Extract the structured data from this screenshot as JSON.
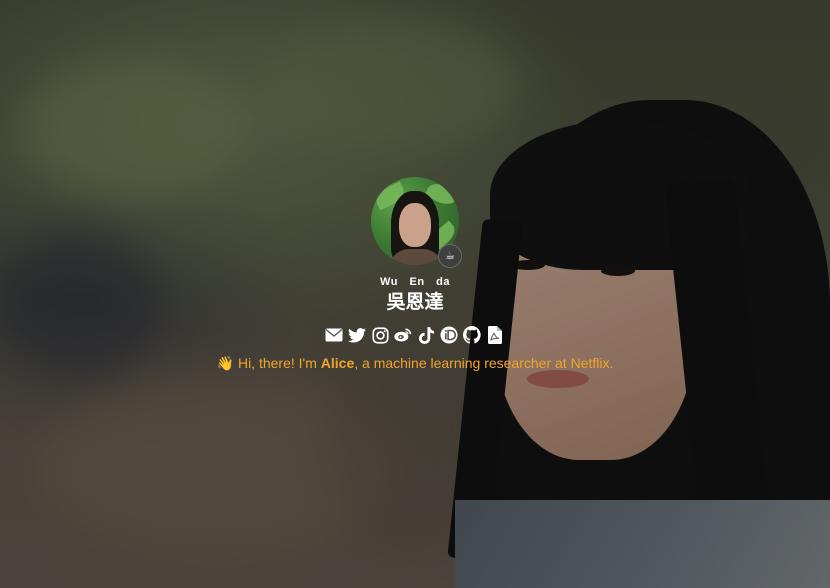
{
  "profile": {
    "name_romanized": "Wu En da",
    "name_chinese": "吳恩達",
    "avatar_badge_icon": "coffee-icon",
    "tagline_prefix": "👋 Hi, there! I'm ",
    "tagline_name": "Alice",
    "tagline_suffix": ", a machine learning researcher at Netflix."
  },
  "social_links": [
    {
      "name": "email",
      "icon": "email-icon"
    },
    {
      "name": "twitter",
      "icon": "twitter-icon"
    },
    {
      "name": "instagram",
      "icon": "instagram-icon"
    },
    {
      "name": "weibo",
      "icon": "weibo-icon"
    },
    {
      "name": "tiktok",
      "icon": "tiktok-icon"
    },
    {
      "name": "orcid",
      "icon": "orcid-icon"
    },
    {
      "name": "github",
      "icon": "github-icon"
    },
    {
      "name": "cv-pdf",
      "icon": "file-pdf-icon"
    }
  ],
  "colors": {
    "tagline": "#f0a52c",
    "name_text": "#ffffff",
    "icon": "#ffffff"
  }
}
